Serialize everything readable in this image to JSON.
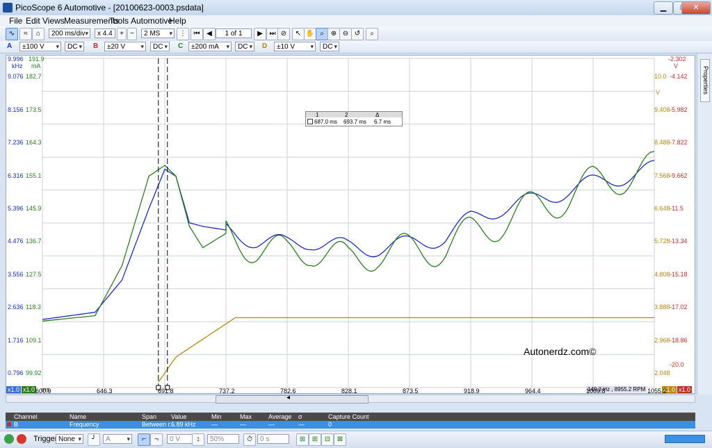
{
  "window": {
    "title": "PicoScope 6 Automotive - [20100623-0003.psdata]",
    "controls": [
      "▁",
      "□",
      "✕"
    ]
  },
  "menu": [
    "File",
    "Edit",
    "Views",
    "Measurements",
    "Tools",
    "Automotive",
    "Help"
  ],
  "toolbar1": {
    "timebase": "200 ms/div",
    "zoom": "x 4.4",
    "samples": "2 MS",
    "buffer": "1 of 1"
  },
  "channels": [
    {
      "letter": "A",
      "range": "±100 V",
      "coupling": "DC",
      "color": "#1a2bbf"
    },
    {
      "letter": "B",
      "range": "±20 V",
      "coupling": "DC",
      "color": "#c0302a"
    },
    {
      "letter": "C",
      "range": "±200 mA",
      "coupling": "DC",
      "color": "#2a7d1e"
    },
    {
      "letter": "D",
      "range": "±10 V",
      "coupling": "DC",
      "color": "#b8860b"
    }
  ],
  "scales": {
    "blue_top": "9.996",
    "blue_unit": "kHz",
    "blue": [
      "9.076",
      "8.156",
      "7.236",
      "6.316",
      "5.396",
      "4.476",
      "3.556",
      "2.636",
      "1.716",
      "0.796"
    ],
    "green_top": "191.9",
    "green_unit": "mA",
    "green": [
      "182.7",
      "173.5",
      "164.3",
      "155.1",
      "145.9",
      "136.7",
      "127.5",
      "118.3",
      "109.1",
      "99.92"
    ],
    "gold_unit": "V",
    "gold": [
      "10.0",
      "9.408",
      "8.488",
      "7.568",
      "6.648",
      "5.728",
      "4.808",
      "3.888",
      "2.968",
      "2.048"
    ],
    "red_top": "-2.302",
    "red_unit": "V",
    "red": [
      "-4.142",
      "-5.982",
      "-7.822",
      "-9.662",
      "-11.5",
      "-13.34",
      "-15.18",
      "-17.02",
      "-18.86",
      "-20.0"
    ],
    "x_unit": "ms",
    "x": [
      "600.9",
      "646.3",
      "691.8",
      "737.2",
      "782.6",
      "828.1",
      "873.5",
      "918.9",
      "964.4",
      "1009.8",
      "1055.2"
    ],
    "x_left_badge": "x1.0",
    "x_right_badge": "x1.0"
  },
  "rulers": {
    "headers": [
      "1",
      "2",
      "Δ"
    ],
    "values": [
      "687.0 ms",
      "693.7 ms",
      "6.7 ms"
    ]
  },
  "status_readout": "149.3 Hz , 8955.2 RPM",
  "watermark": "Autonerdz.com©",
  "measurements": {
    "columns": [
      "Channel",
      "Name",
      "Span",
      "Value",
      "Min",
      "Max",
      "Average",
      "σ",
      "Capture Count"
    ],
    "row": [
      "B",
      "Frequency",
      "Between r...",
      "6.89 kHz",
      "—",
      "—",
      "—",
      "—",
      "0"
    ]
  },
  "statusbar": {
    "trigger_label": "Trigger",
    "trigger_mode": "None",
    "trigger_channel": "A",
    "threshold": "0 V",
    "pre_trigger": "50%",
    "delay": "0 s"
  },
  "chart_data": {
    "type": "line",
    "x_range": [
      600.9,
      1055.2
    ],
    "x_unit": "ms",
    "series": [
      {
        "name": "kHz",
        "color": "#1a2bbf",
        "x": [
          600.9,
          640,
          660,
          680,
          691.8,
          700,
          710,
          720,
          737.2,
          760,
          782.6,
          800,
          828.1,
          850,
          873.5,
          900,
          918.9,
          940,
          964.4,
          990,
          1009.8,
          1055.2
        ],
        "y": [
          2.7,
          2.9,
          3.8,
          5.8,
          6.9,
          6.7,
          5.4,
          5.3,
          5.2,
          4.9,
          4.8,
          4.9,
          4.7,
          4.7,
          4.8,
          5.0,
          5.5,
          5.8,
          6.0,
          6.3,
          6.5,
          6.9
        ]
      },
      {
        "name": "mA",
        "color": "#2a7d1e",
        "x": [
          600.9,
          640,
          660,
          680,
          691.8,
          700,
          710,
          720,
          737.2,
          760,
          782.6,
          800,
          828.1,
          850,
          873.5,
          900,
          918.9,
          940,
          964.4,
          990,
          1009.8,
          1055.2
        ],
        "y": [
          118.5,
          120,
          134,
          159,
          162,
          159,
          145,
          139,
          143,
          139,
          137,
          139,
          135,
          138,
          138,
          139,
          143,
          146,
          150,
          153,
          157,
          161
        ]
      },
      {
        "name": "V",
        "color": "#b8860b",
        "x": [
          687,
          700,
          720,
          744,
          760,
          800,
          850,
          900,
          950,
          1000,
          1055.2
        ],
        "y": [
          2.2,
          2.9,
          3.4,
          4.0,
          4.0,
          4.0,
          4.0,
          4.0,
          4.0,
          4.0,
          4.0
        ]
      }
    ],
    "cursors_ms": [
      687.0,
      693.7
    ],
    "grid": true
  }
}
